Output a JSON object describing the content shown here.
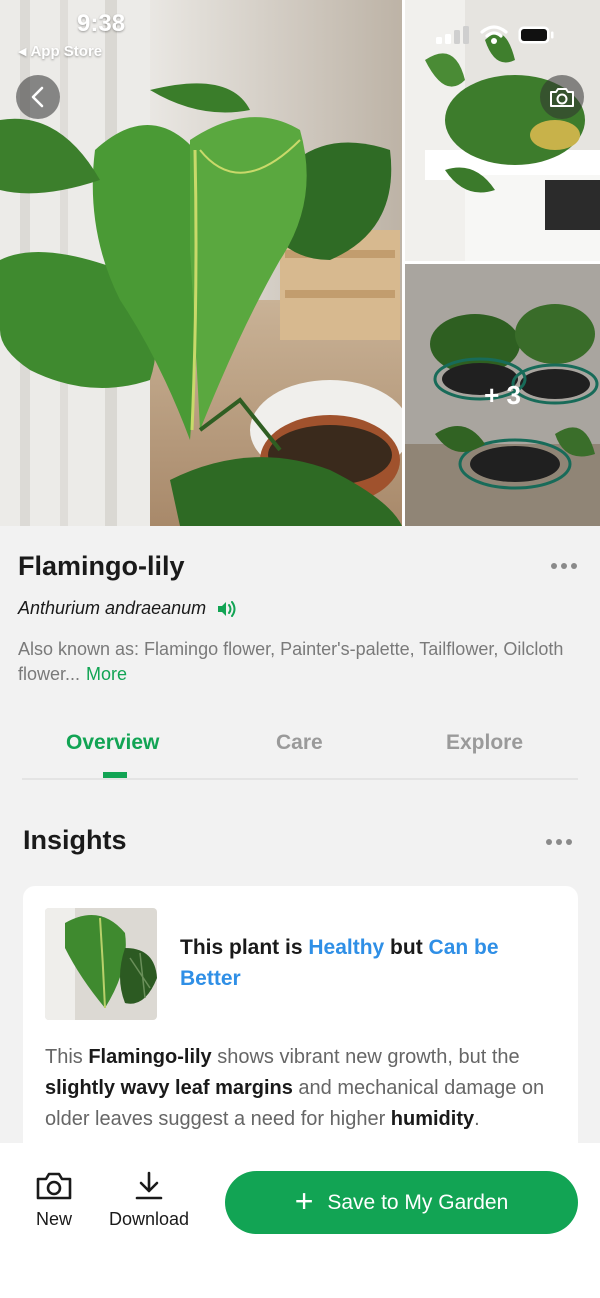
{
  "status_bar": {
    "time": "9:38",
    "back_app": "App Store"
  },
  "gallery": {
    "more_count": "+ 3"
  },
  "plant": {
    "name": "Flamingo-lily",
    "scientific_name": "Anthurium andraeanum",
    "also_known_as": "Also known as: Flamingo flower, Painter's-palette, Tailflower, Oilcloth flower...",
    "more_label": "More"
  },
  "tabs": [
    {
      "label": "Overview",
      "active": true
    },
    {
      "label": "Care",
      "active": false
    },
    {
      "label": "Explore",
      "active": false
    }
  ],
  "insights": {
    "title": "Insights",
    "health_prefix": "This plant is ",
    "health_status": "Healthy",
    "health_middle": " but ",
    "health_suggestion": "Can be Better",
    "body": {
      "p1": "This ",
      "b1": "Flamingo-lily",
      "p2": " shows vibrant new growth, but the ",
      "b2": "slightly wavy leaf margins",
      "p3": " and mechanical damage on older leaves suggest a need for higher ",
      "b3": "humidity",
      "p4": "."
    }
  },
  "bottom_bar": {
    "new_label": "New",
    "download_label": "Download",
    "save_label": "Save to My Garden"
  },
  "colors": {
    "accent": "#12a454",
    "link_blue": "#2f8fe6"
  },
  "icons": [
    "back-chevron-icon",
    "camera-icon",
    "speaker-icon",
    "more-dots-icon",
    "download-icon",
    "plus-icon"
  ]
}
